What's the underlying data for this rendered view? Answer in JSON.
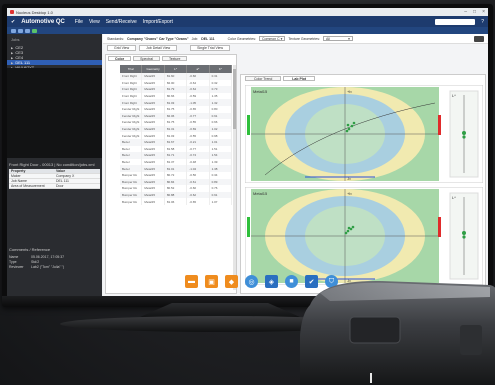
{
  "window": {
    "title": "Nucleus Desktop 1.0"
  },
  "menubar": {
    "app_name": "Automotive QC",
    "items": [
      "File",
      "View",
      "Send/Receive",
      "Import/Export"
    ]
  },
  "left_panel": {
    "jobs_header": "Jobs",
    "tree": [
      {
        "label": "CE2"
      },
      {
        "label": "CE3"
      },
      {
        "label": "CE4"
      },
      {
        "label": "DEL 111",
        "selected": true
      },
      {
        "label": "WVU67YT"
      }
    ],
    "properties_title": "Front Right Door - 00013 | No condition/jobs.xml",
    "properties_header": {
      "k": "Property",
      "v": "Value"
    },
    "properties": [
      {
        "k": "Maker",
        "v": "Company X"
      },
      {
        "k": "Job Name",
        "v": "DEL 111"
      },
      {
        "k": "Area of Measurement",
        "v": "Door"
      }
    ],
    "comments_title": "Comments / Reference",
    "comments": [
      {
        "k": "Name",
        "v": "05.06.2017, 17:05:37"
      },
      {
        "k": "Type",
        "v": "Std/2"
      },
      {
        "k": "Reviewer",
        "v": "Lab2 (\"Tom\" \"Julia\" \")"
      }
    ]
  },
  "filterbar": {
    "standards_label": "Standards:",
    "standards_value": "Company \"Ovans\" Car Type \"Ovans\"",
    "job_label": "Job:",
    "job_value": "DEL 111",
    "color_label": "Color Geometries:",
    "color_value": "Common C",
    "texture_label": "Texture Geometries:",
    "texture_value": "All"
  },
  "viewtabs": [
    "Grid View",
    "Job Detail View",
    "Single Trial View"
  ],
  "subtabs": [
    {
      "label": "Color",
      "active": true
    },
    {
      "label": "Spectral"
    },
    {
      "label": "Texture"
    }
  ],
  "grid": {
    "headers": [
      "Trial",
      "Geometry",
      "L*",
      "a*",
      "b*"
    ],
    "rows": [
      [
        "Front Right",
        "Metal15",
        "81.60",
        "-0.66",
        "0.31"
      ],
      [
        "Front Right",
        "Metal15",
        "82.00",
        "-0.64",
        "0.32"
      ],
      [
        "Front Right",
        "Metal15",
        "81.79",
        "-0.64",
        "0.73"
      ],
      [
        "Front Right",
        "Metal15",
        "80.66",
        "-0.59",
        "1.35"
      ],
      [
        "Front Right",
        "Metal15",
        "81.03",
        "-1.05",
        "1.32"
      ],
      [
        "Fender Right",
        "Metal15",
        "81.75",
        "-0.65",
        "0.80"
      ],
      [
        "Fender Right",
        "Metal15",
        "82.06",
        "-0.77",
        "0.91"
      ],
      [
        "Fender Right",
        "Metal15",
        "81.75",
        "-0.55",
        "0.66"
      ],
      [
        "Fender Right",
        "Metal15",
        "81.31",
        "-0.69",
        "1.02"
      ],
      [
        "Fender Right",
        "Metal15",
        "81.03",
        "-0.55",
        "0.98"
      ],
      [
        "Bezel",
        "Metal15",
        "81.67",
        "-0.21",
        "1.01"
      ],
      [
        "Bezel",
        "Metal15",
        "81.58",
        "-0.77",
        "1.51"
      ],
      [
        "Bezel",
        "Metal15",
        "81.71",
        "-0.74",
        "1.54"
      ],
      [
        "Bezel",
        "Metal15",
        "81.37",
        "-0.48",
        "1.39"
      ],
      [
        "Bezel",
        "Metal15",
        "81.01",
        "-1.04",
        "1.38"
      ],
      [
        "Bumper Ro",
        "Metal15",
        "80.72",
        "-0.56",
        "0.34"
      ],
      [
        "Bumper Ro",
        "Metal15",
        "80.84",
        "-0.61",
        "0.89"
      ],
      [
        "Bumper Ro",
        "Metal15",
        "80.52",
        "-0.60",
        "0.76"
      ],
      [
        "Bumper Ro",
        "Metal15",
        "80.88",
        "-0.62",
        "0.91"
      ],
      [
        "Bumper Ro",
        "Metal15",
        "81.06",
        "-0.65",
        "1.07"
      ]
    ]
  },
  "charttabs": [
    {
      "label": "Color Trend"
    },
    {
      "label": "Lab Plot",
      "active": true
    }
  ],
  "plot_labels": {
    "top_left": "Metal15",
    "bottom_left": "Metal15",
    "axis_pos": "+b",
    "axis_neg": "-b",
    "lstar": "L*"
  },
  "dock": {
    "icons": [
      "folder-icon",
      "briefcase-icon",
      "tag-icon",
      "globe-icon",
      "layers-icon",
      "cube-icon",
      "check-icon",
      "shield-icon"
    ]
  },
  "colors": {
    "menubar": "#1d3b6e",
    "selection": "#2f5fb5",
    "plot_green": "#a7d7a8",
    "plot_yellow": "#f1eab0",
    "plot_blue": "#a9cfe0",
    "dock_orange": "#ef8c1e",
    "dock_blue": "#3f8fd8"
  }
}
